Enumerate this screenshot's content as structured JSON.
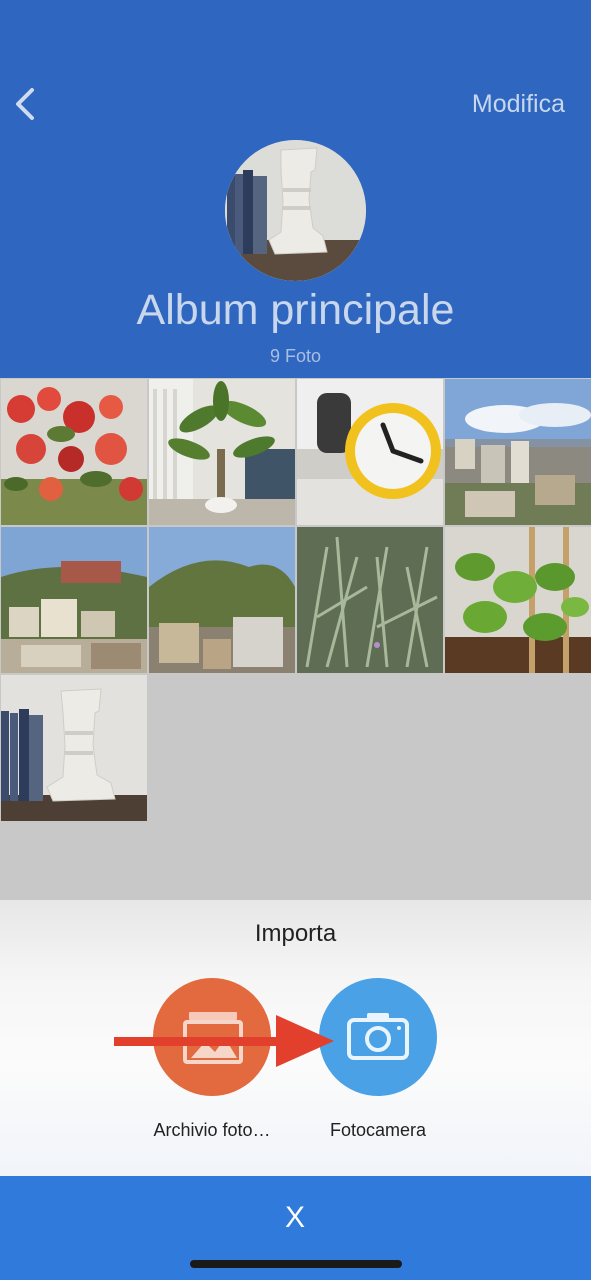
{
  "header": {
    "edit_label": "Modifica",
    "title": "Album principale",
    "photo_count": "9 Foto",
    "back_icon": "chevron-left-icon"
  },
  "colors": {
    "header_bg": "#2f66bf",
    "footer_bg": "#2f7ada",
    "gallery_button": "#e3693f",
    "camera_button": "#4aa1e6",
    "arrow": "#e23f2c"
  },
  "photos": [
    {
      "name": "photo-red-flowers"
    },
    {
      "name": "photo-indoor-plant"
    },
    {
      "name": "photo-yellow-clock"
    },
    {
      "name": "photo-city-skyline"
    },
    {
      "name": "photo-hillside-buildings-1"
    },
    {
      "name": "photo-hillside-buildings-2"
    },
    {
      "name": "photo-lavender-bush"
    },
    {
      "name": "photo-mint-plant"
    },
    {
      "name": "photo-white-sculpture"
    }
  ],
  "import_sheet": {
    "title": "Importa",
    "actions": [
      {
        "label": "Archivio foto…",
        "icon": "photo-library-icon"
      },
      {
        "label": "Fotocamera",
        "icon": "camera-icon"
      }
    ]
  },
  "footer": {
    "close_label": "X"
  }
}
